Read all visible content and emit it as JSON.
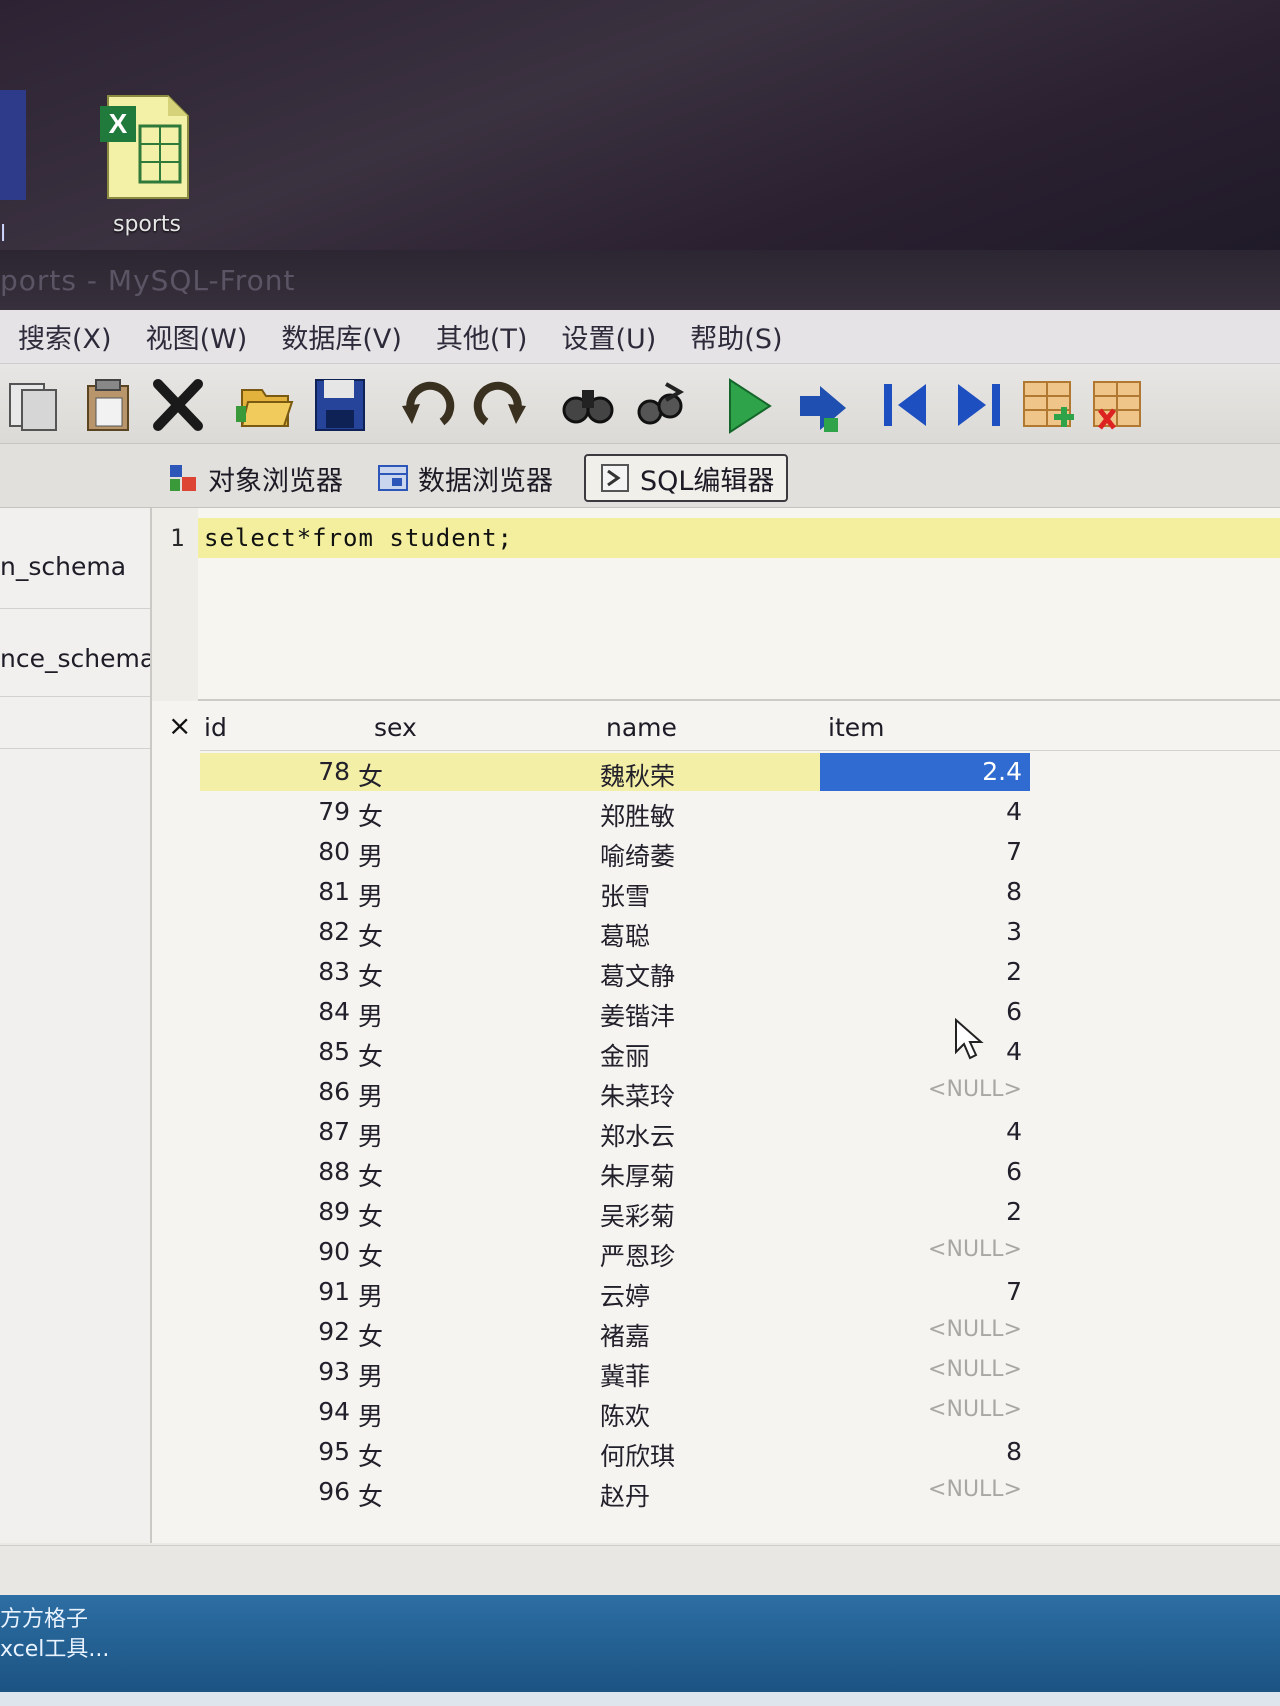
{
  "desktop": {
    "edge_label": "l",
    "icon_label": "sports"
  },
  "window": {
    "title": "ports - MySQL-Front"
  },
  "menu": [
    "搜索(X)",
    "视图(W)",
    "数据库(V)",
    "其他(T)",
    "设置(U)",
    "帮助(S)"
  ],
  "toolbar_icons": [
    "copy-icon",
    "paste-icon",
    "delete-icon",
    "open-icon",
    "save-icon",
    "undo-icon",
    "redo-icon",
    "find-icon",
    "replace-icon",
    "run-icon",
    "run-selection-icon",
    "first-record-icon",
    "last-record-icon",
    "insert-record-icon",
    "delete-record-icon"
  ],
  "tabs": {
    "object_browser": "对象浏览器",
    "data_browser": "数据浏览器",
    "sql_editor": "SQL编辑器"
  },
  "tree": {
    "items": [
      "n_schema",
      "nce_schema"
    ]
  },
  "editor": {
    "line_number": "1",
    "code": "select*from student;"
  },
  "result": {
    "close": "×",
    "columns": [
      "id",
      "sex",
      "name",
      "item"
    ],
    "rows": [
      {
        "id": "78",
        "sex": "女",
        "name": "魏秋荣",
        "item": "2.4"
      },
      {
        "id": "79",
        "sex": "女",
        "name": "郑胜敏",
        "item": "4"
      },
      {
        "id": "80",
        "sex": "男",
        "name": "喻绮萎",
        "item": "7"
      },
      {
        "id": "81",
        "sex": "男",
        "name": "张雪",
        "item": "8"
      },
      {
        "id": "82",
        "sex": "女",
        "name": "葛聪",
        "item": "3"
      },
      {
        "id": "83",
        "sex": "女",
        "name": "葛文静",
        "item": "2"
      },
      {
        "id": "84",
        "sex": "男",
        "name": "姜锴沣",
        "item": "6"
      },
      {
        "id": "85",
        "sex": "女",
        "name": "金丽",
        "item": "4"
      },
      {
        "id": "86",
        "sex": "男",
        "name": "朱菜玲",
        "item": "<NULL>"
      },
      {
        "id": "87",
        "sex": "男",
        "name": "郑水云",
        "item": "4"
      },
      {
        "id": "88",
        "sex": "女",
        "name": "朱厚菊",
        "item": "6"
      },
      {
        "id": "89",
        "sex": "女",
        "name": "吴彩菊",
        "item": "2"
      },
      {
        "id": "90",
        "sex": "女",
        "name": "严恩珍",
        "item": "<NULL>"
      },
      {
        "id": "91",
        "sex": "男",
        "name": "云婷",
        "item": "7"
      },
      {
        "id": "92",
        "sex": "女",
        "name": "褚嘉",
        "item": "<NULL>"
      },
      {
        "id": "93",
        "sex": "男",
        "name": "冀菲",
        "item": "<NULL>"
      },
      {
        "id": "94",
        "sex": "男",
        "name": "陈欢",
        "item": "<NULL>"
      },
      {
        "id": "95",
        "sex": "女",
        "name": "何欣琪",
        "item": "8"
      },
      {
        "id": "96",
        "sex": "女",
        "name": "赵丹",
        "item": "<NULL>"
      }
    ]
  },
  "taskbar": {
    "line1": "方方格子",
    "line2": "xcel工具..."
  },
  "colors": {
    "selection_blue": "#2f6bd0",
    "row_highlight": "#f4efa6",
    "editor_line_highlight": "#f3ef9f",
    "taskbar": "#19507e"
  }
}
